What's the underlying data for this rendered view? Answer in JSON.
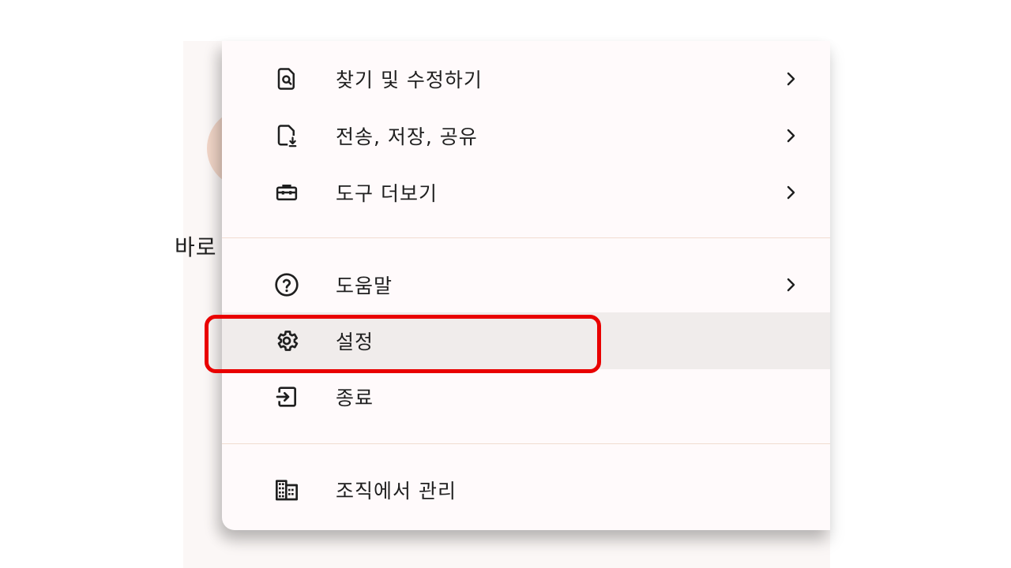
{
  "background": {
    "partial_text": "바로",
    "avatar_color": "#f2d6c8"
  },
  "menu": {
    "items": [
      {
        "label": "찾기 및 수정하기",
        "icon": "find-in-page-icon",
        "has_submenu": true
      },
      {
        "label": "전송, 저장, 공유",
        "icon": "file-download-icon",
        "has_submenu": true
      },
      {
        "label": "도구 더보기",
        "icon": "toolbox-icon",
        "has_submenu": true
      },
      {
        "label": "도움말",
        "icon": "help-icon",
        "has_submenu": true
      },
      {
        "label": "설정",
        "icon": "settings-icon",
        "has_submenu": false,
        "state": "hovered"
      },
      {
        "label": "종료",
        "icon": "exit-icon",
        "has_submenu": false
      },
      {
        "label": "조직에서 관리",
        "icon": "domain-icon",
        "has_submenu": false
      }
    ]
  },
  "colors": {
    "menu_background": "#fffafb",
    "hover_background": "#f0eceb",
    "divider": "#f1dcd0",
    "highlight_border": "#e90000"
  }
}
